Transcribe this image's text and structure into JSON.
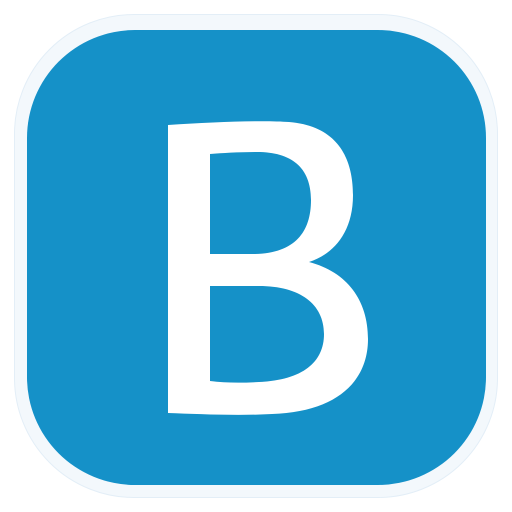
{
  "icon": {
    "name": "b-letter-app-icon",
    "letter": "B",
    "colors": {
      "tile": "#1591c8",
      "letter": "#ffffff",
      "outer_ring": "#f3f8fc"
    }
  }
}
